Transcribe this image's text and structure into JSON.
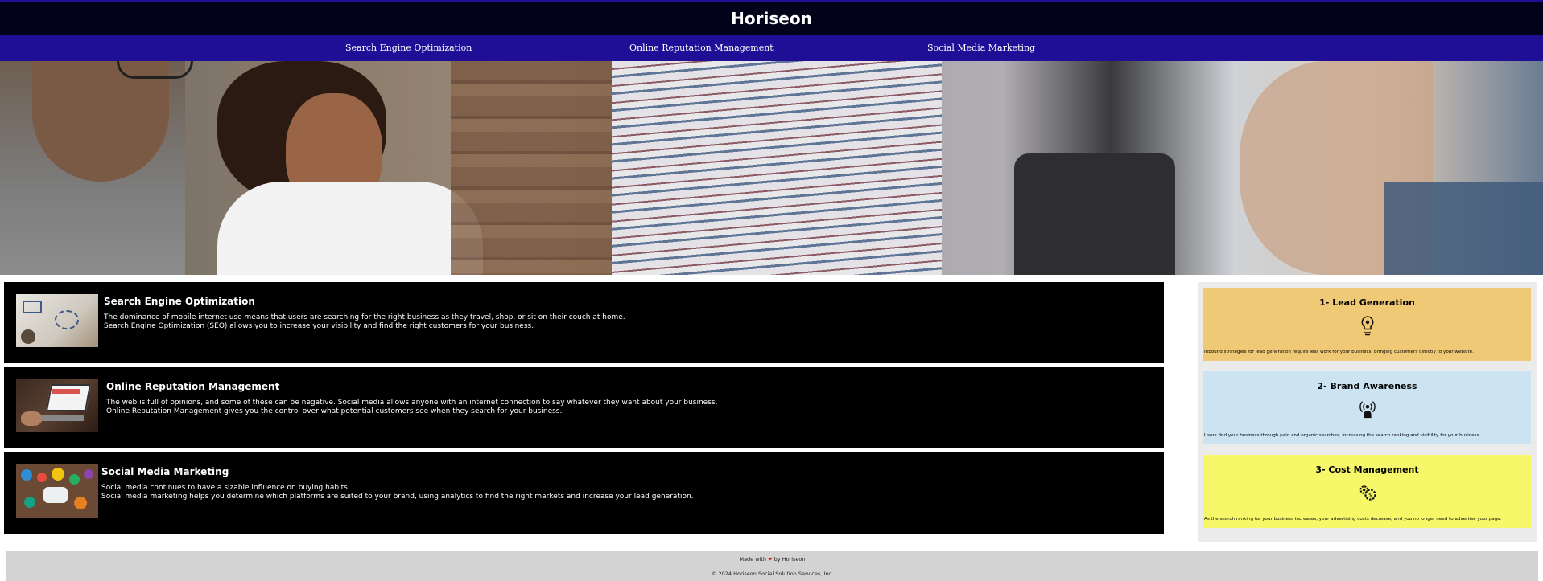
{
  "header": {
    "brand": "Horiseon",
    "nav": [
      {
        "label": "Search Engine Optimization"
      },
      {
        "label": "Online Reputation Management"
      },
      {
        "label": "Social Media Marketing"
      }
    ]
  },
  "services": [
    {
      "title": "Search Engine Optimization",
      "line1": "The dominance of mobile internet use means that users are searching for the right business as they travel, shop, or sit on their couch at home.",
      "line2": "Search Engine Optimization (SEO) allows you to increase your visibility and find the right customers for your business."
    },
    {
      "title": "Online Reputation Management",
      "line1": "The web is full of opinions, and some of these can be negative. Social media allows anyone with an internet connection to say whatever they want about your business.",
      "line2": "Online Reputation Management gives you the control over what potential customers see when they search for your business."
    },
    {
      "title": "Social Media Marketing",
      "line1": "Social media continues to have a sizable influence on buying habits.",
      "line2": "Social media marketing helps you determine which platforms are suited to your brand, using analytics to find the right markets and increase your lead generation."
    }
  ],
  "benefits": [
    {
      "title": "1- Lead Generation",
      "icon": "lightbulb-person-icon",
      "text": "Inbound strategies for lead generation require less work for your business, bringing customers directly to your website.",
      "color": "#f0c976"
    },
    {
      "title": "2- Brand Awareness",
      "icon": "broadcast-person-icon",
      "text": "Users find your business through paid and organic searches, increasing the search ranking and visibility for your business.",
      "color": "#cce4f2"
    },
    {
      "title": "3- Cost Management",
      "icon": "gears-dollar-icon",
      "text": "As the search ranking for your business increases, your advertising costs decrease, and you no longer need to advertise your page.",
      "color": "#f7f76a"
    }
  ],
  "footer": {
    "made_prefix": "Made with",
    "heart": "❤",
    "made_suffix": "by Horiseon",
    "copyright": "© 2024 Horiseon Social Solution Services, Inc."
  },
  "colors": {
    "brand_bar": "#02021a",
    "nav_bar": "#1e0f96",
    "service_bg": "#000000",
    "benefit_panel": "#ebebeb",
    "footer_bg": "#d3d3d3"
  }
}
